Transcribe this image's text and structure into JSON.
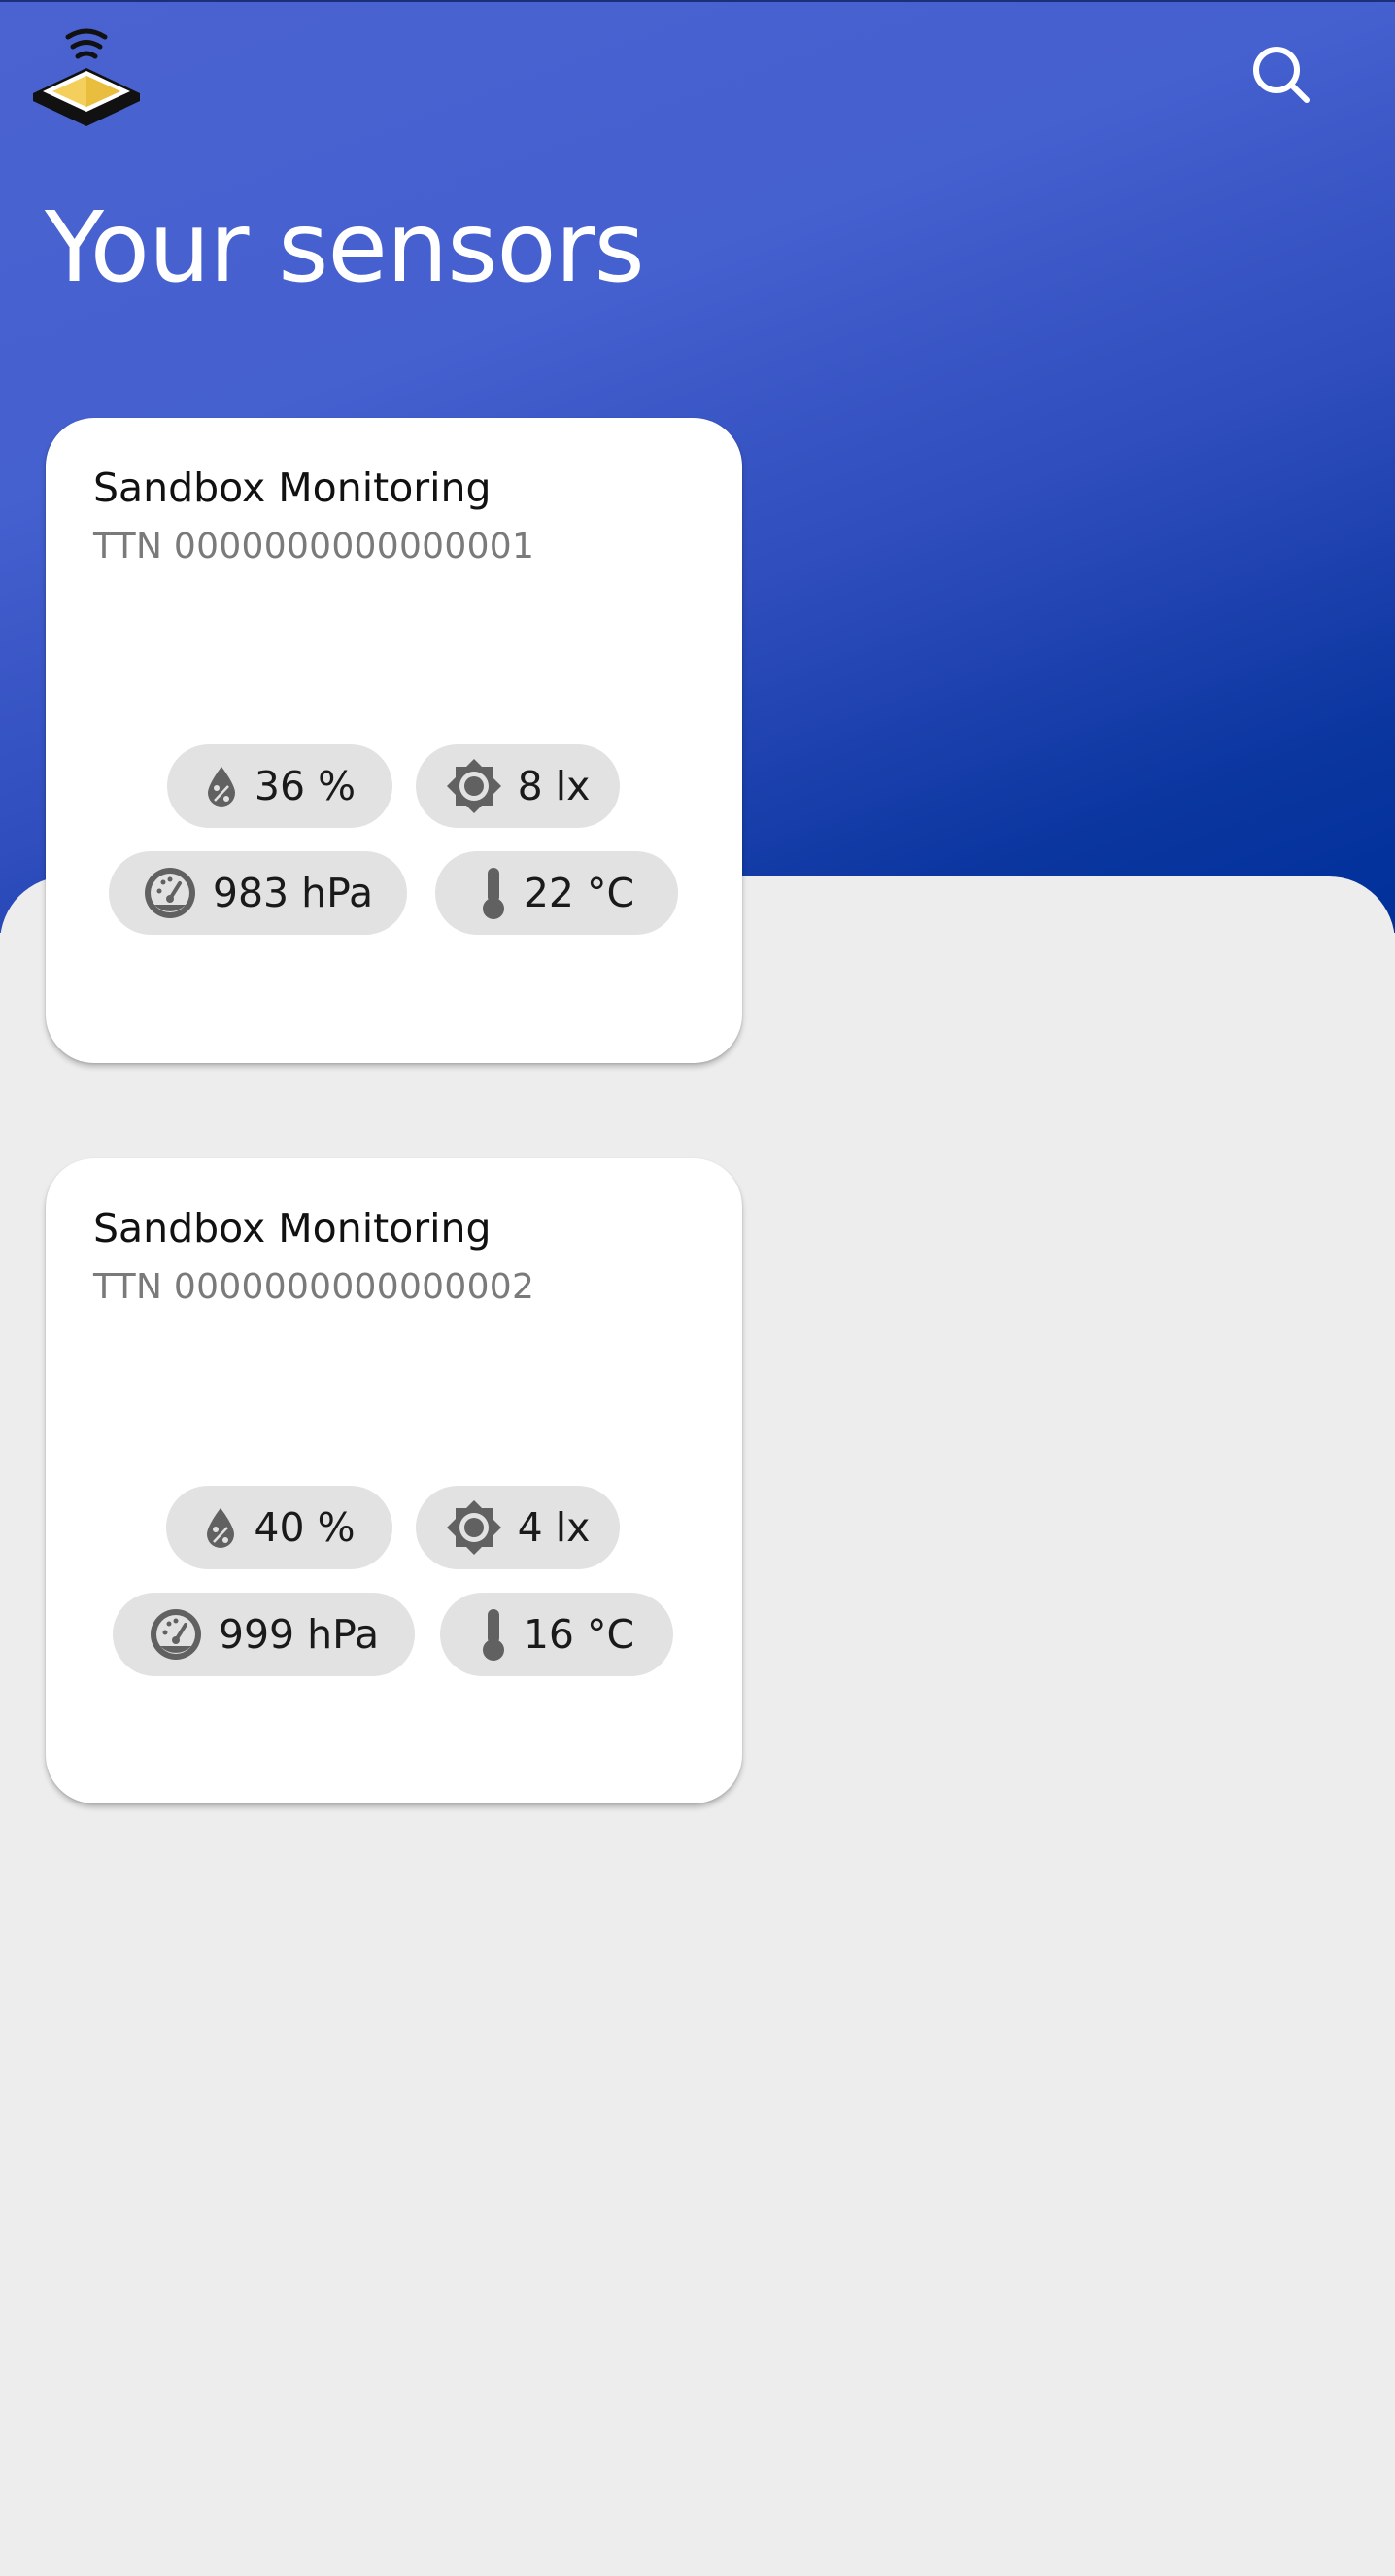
{
  "header": {
    "title": "Your sensors",
    "logo_icon": "app-logo-icon",
    "search_icon": "search-icon"
  },
  "colors": {
    "header_gradient_start": "#4a63d0",
    "header_gradient_end": "#00309a",
    "background": "#ededed",
    "card": "#ffffff",
    "chip": "#e2e2e2",
    "icon": "#616161"
  },
  "sensors": [
    {
      "name": "Sandbox Monitoring",
      "id": "TTN 0000000000000001",
      "humidity": "36 %",
      "light": "8 lx",
      "pressure": "983 hPa",
      "temperature": "22 °C"
    },
    {
      "name": "Sandbox Monitoring",
      "id": "TTN 0000000000000002",
      "humidity": "40 %",
      "light": "4 lx",
      "pressure": "999 hPa",
      "temperature": "16 °C"
    }
  ]
}
